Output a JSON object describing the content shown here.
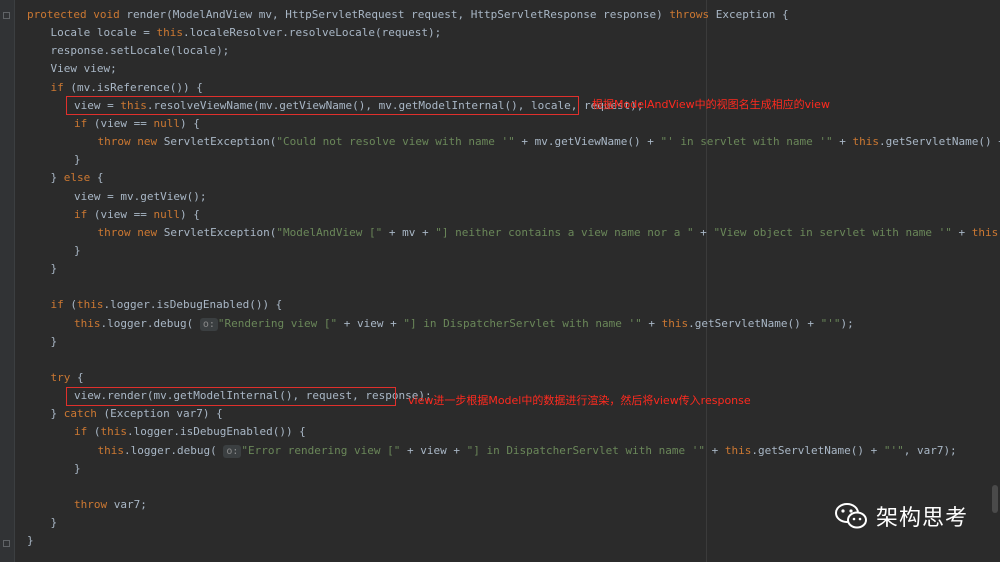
{
  "code_lines": [
    {
      "indent": 0,
      "tokens": [
        [
          "kw",
          "protected void "
        ],
        [
          "plain",
          "render(ModelAndView mv, HttpServletRequest request, HttpServletResponse response) "
        ],
        [
          "kw",
          "throws "
        ],
        [
          "plain",
          "Exception {"
        ]
      ]
    },
    {
      "indent": 1,
      "tokens": [
        [
          "plain",
          "Locale locale = "
        ],
        [
          "kw",
          "this"
        ],
        [
          "plain",
          ".localeResolver.resolveLocale(request);"
        ]
      ]
    },
    {
      "indent": 1,
      "tokens": [
        [
          "plain",
          "response.setLocale(locale);"
        ]
      ]
    },
    {
      "indent": 1,
      "tokens": [
        [
          "plain",
          "View view;"
        ]
      ]
    },
    {
      "indent": 1,
      "tokens": [
        [
          "kw",
          "if "
        ],
        [
          "plain",
          "(mv.isReference()) {"
        ]
      ]
    },
    {
      "indent": 2,
      "tokens": [
        [
          "plain",
          "view = "
        ],
        [
          "kw",
          "this"
        ],
        [
          "plain",
          ".resolveViewName(mv.getViewName(), mv.getModelInternal(), locale, request);"
        ]
      ]
    },
    {
      "indent": 2,
      "tokens": [
        [
          "kw",
          "if "
        ],
        [
          "plain",
          "(view == "
        ],
        [
          "kw",
          "null"
        ],
        [
          "plain",
          ") {"
        ]
      ]
    },
    {
      "indent": 3,
      "tokens": [
        [
          "kw",
          "throw new "
        ],
        [
          "plain",
          "ServletException("
        ],
        [
          "str",
          "\"Could not resolve view with name '\""
        ],
        [
          "plain",
          " + mv.getViewName() + "
        ],
        [
          "str",
          "\"' in servlet with name '\""
        ],
        [
          "plain",
          " + "
        ],
        [
          "kw",
          "this"
        ],
        [
          "plain",
          ".getServletName() + "
        ],
        [
          "str",
          "\"'\""
        ],
        [
          "plain",
          ");"
        ]
      ]
    },
    {
      "indent": 2,
      "tokens": [
        [
          "plain",
          "}"
        ]
      ]
    },
    {
      "indent": 1,
      "tokens": [
        [
          "plain",
          "} "
        ],
        [
          "kw",
          "else "
        ],
        [
          "plain",
          "{"
        ]
      ]
    },
    {
      "indent": 2,
      "tokens": [
        [
          "plain",
          "view = mv.getView();"
        ]
      ]
    },
    {
      "indent": 2,
      "tokens": [
        [
          "kw",
          "if "
        ],
        [
          "plain",
          "(view == "
        ],
        [
          "kw",
          "null"
        ],
        [
          "plain",
          ") {"
        ]
      ]
    },
    {
      "indent": 3,
      "tokens": [
        [
          "kw",
          "throw new "
        ],
        [
          "plain",
          "ServletException("
        ],
        [
          "str",
          "\"ModelAndView [\""
        ],
        [
          "plain",
          " + mv + "
        ],
        [
          "str",
          "\"] neither contains a view name nor a \""
        ],
        [
          "plain",
          " + "
        ],
        [
          "str",
          "\"View object in servlet with name '\""
        ],
        [
          "plain",
          " + "
        ],
        [
          "kw",
          "this"
        ],
        [
          "plain",
          ".getServletName() + "
        ]
      ]
    },
    {
      "indent": 2,
      "tokens": [
        [
          "plain",
          "}"
        ]
      ]
    },
    {
      "indent": 1,
      "tokens": [
        [
          "plain",
          "}"
        ]
      ]
    },
    {
      "indent": 0,
      "tokens": []
    },
    {
      "indent": 1,
      "tokens": [
        [
          "kw",
          "if "
        ],
        [
          "plain",
          "("
        ],
        [
          "kw",
          "this"
        ],
        [
          "plain",
          ".logger.isDebugEnabled()) {"
        ]
      ]
    },
    {
      "indent": 2,
      "tokens": [
        [
          "kw",
          "this"
        ],
        [
          "plain",
          ".logger.debug( "
        ],
        [
          "hint",
          "o:"
        ],
        [
          "str",
          "\"Rendering view [\""
        ],
        [
          "plain",
          " + view + "
        ],
        [
          "str",
          "\"] in DispatcherServlet with name '\""
        ],
        [
          "plain",
          " + "
        ],
        [
          "kw",
          "this"
        ],
        [
          "plain",
          ".getServletName() + "
        ],
        [
          "str",
          "\"'\""
        ],
        [
          "plain",
          ");"
        ]
      ]
    },
    {
      "indent": 1,
      "tokens": [
        [
          "plain",
          "}"
        ]
      ]
    },
    {
      "indent": 0,
      "tokens": []
    },
    {
      "indent": 1,
      "tokens": [
        [
          "kw",
          "try "
        ],
        [
          "plain",
          "{"
        ]
      ]
    },
    {
      "indent": 2,
      "tokens": [
        [
          "plain",
          "view.render(mv.getModelInternal(), request, response);"
        ]
      ]
    },
    {
      "indent": 1,
      "tokens": [
        [
          "plain",
          "} "
        ],
        [
          "kw",
          "catch "
        ],
        [
          "plain",
          "(Exception var7) {"
        ]
      ]
    },
    {
      "indent": 2,
      "tokens": [
        [
          "kw",
          "if "
        ],
        [
          "plain",
          "("
        ],
        [
          "kw",
          "this"
        ],
        [
          "plain",
          ".logger.isDebugEnabled()) {"
        ]
      ]
    },
    {
      "indent": 3,
      "tokens": [
        [
          "kw",
          "this"
        ],
        [
          "plain",
          ".logger.debug( "
        ],
        [
          "hint",
          "o:"
        ],
        [
          "str",
          "\"Error rendering view [\""
        ],
        [
          "plain",
          " + view + "
        ],
        [
          "str",
          "\"] in DispatcherServlet with name '\""
        ],
        [
          "plain",
          " + "
        ],
        [
          "kw",
          "this"
        ],
        [
          "plain",
          ".getServletName() + "
        ],
        [
          "str",
          "\"'\""
        ],
        [
          "plain",
          ", var7);"
        ]
      ]
    },
    {
      "indent": 2,
      "tokens": [
        [
          "plain",
          "}"
        ]
      ]
    },
    {
      "indent": 0,
      "tokens": []
    },
    {
      "indent": 2,
      "tokens": [
        [
          "kw",
          "throw "
        ],
        [
          "plain",
          "var7;"
        ]
      ]
    },
    {
      "indent": 1,
      "tokens": [
        [
          "plain",
          "}"
        ]
      ]
    },
    {
      "indent": 0,
      "tokens": [
        [
          "plain",
          "}"
        ]
      ]
    }
  ],
  "annotations": {
    "resolve_view": "根据ModelAndView中的视图名生成相应的view",
    "render_view": "view进一步根据Model中的数据进行渲染，然后将view传入response"
  },
  "watermark": {
    "text": "架构思考",
    "icon": "wechat-icon"
  },
  "colors": {
    "background": "#2b2b2b",
    "keyword": "#cc7832",
    "string": "#6a8759",
    "identifier": "#a9b7c6",
    "annotation": "#ff2a1f"
  }
}
